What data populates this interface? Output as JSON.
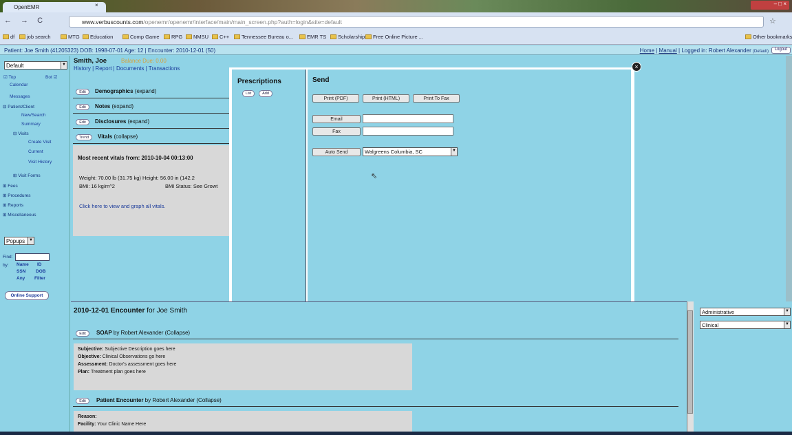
{
  "browser": {
    "tab_title": "OpenEMR",
    "tab_close": "×",
    "nav_buttons": "← → C",
    "url_host": "www.verbuscounts.com",
    "url_path": "/openemr/openemr/interface/main/main_screen.php?auth=login&site=default",
    "window_controls": "– □ ×",
    "bookmarks": [
      "df",
      "job search",
      "MTG",
      "Education",
      "Comp Game",
      "RPG",
      "NMSU",
      "C++",
      "Tennessee Bureau o...",
      "EMR TS",
      "Scholarships",
      "Free Online Picture ..."
    ],
    "other_bookmarks": "Other bookmarks"
  },
  "header": {
    "patient_line": "Patient: Joe Smith (41205323) DOB: 1998-07-01 Age: 12 | Encounter: 2010-12-01 (50)",
    "home": "Home",
    "manual": "Manual",
    "logged_in": "| Logged in: Robert Alexander",
    "default_label": "(Default)",
    "logout": "Logout"
  },
  "left_nav": {
    "select_default": "Default",
    "top_label": "Top",
    "bot_label": "Bot",
    "items": [
      "Calendar",
      "Messages",
      "Patient/Client",
      "New/Search",
      "Summary",
      "Visits",
      "Create Visit",
      "Current",
      "Visit History",
      "Visit Forms",
      "Fees",
      "Procedures",
      "Reports",
      "Miscellaneous"
    ],
    "popups": "Popups",
    "find_label": "Find:",
    "by_label": "by:",
    "find_opts": [
      "Name",
      "ID",
      "SSN",
      "DOB",
      "Any",
      "Filter"
    ],
    "online_support": "Online Support"
  },
  "patient": {
    "name": "Smith, Joe",
    "balance": "Balance Due: 0.00",
    "tabs": "History | Report | Documents | Transactions",
    "sections": [
      {
        "btn": "Edit",
        "title": "Demographics",
        "state": "(expand)"
      },
      {
        "btn": "Edit",
        "title": "Notes",
        "state": "(expand)"
      },
      {
        "btn": "Edit",
        "title": "Disclosures",
        "state": "(expand)"
      },
      {
        "btn": "Trend",
        "title": "Vitals",
        "state": "(collapse)"
      }
    ],
    "vitals_recent": "Most recent vitals from: 2010-10-04 00:13:00",
    "vitals_weight": "Weight: 70.00 lb (31.75 kg) Height: 56.00 in (142.2",
    "vitals_bmi": "BMI: 16 kg/m^2",
    "vitals_bmi_status": "BMI Status: See Growt",
    "vitals_link": "Click here to view and graph all vitals."
  },
  "modal": {
    "prescriptions_title": "Prescriptions",
    "list_btn": "List",
    "add_btn": "Add",
    "send_title": "Send",
    "print_pdf": "Print (PDF)",
    "print_html": "Print (HTML)",
    "print_fax": "Print To Fax",
    "email": "Email",
    "fax": "Fax",
    "auto_send": "Auto Send",
    "pharmacy": "Walgreens Columbia, SC",
    "close": "×"
  },
  "encounter": {
    "title_date": "2010-12-01 Encounter",
    "title_for": " for Joe Smith",
    "soap_btn": "Edit",
    "soap_title": "SOAP",
    "soap_by": " by Robert Alexander (Collapse)",
    "subjective_label": "Subjective:",
    "subjective": " Subjective Description goes here",
    "objective_label": "Objective:",
    "objective": " Clinical Observations go here",
    "assessment_label": "Assessment:",
    "assessment": " Doctor's assessment goes here",
    "plan_label": "Plan:",
    "plan": " Treatment plan goes here",
    "pe_btn": "Edit",
    "pe_title": "Patient Encounter",
    "pe_by": " by Robert Alexander (Collapse)",
    "reason_label": "Reason:",
    "facility_label": "Facility:",
    "facility": " Your Clinic Name Here"
  },
  "right_panel": {
    "sel1": "Administrative",
    "sel2": "Clinical"
  }
}
